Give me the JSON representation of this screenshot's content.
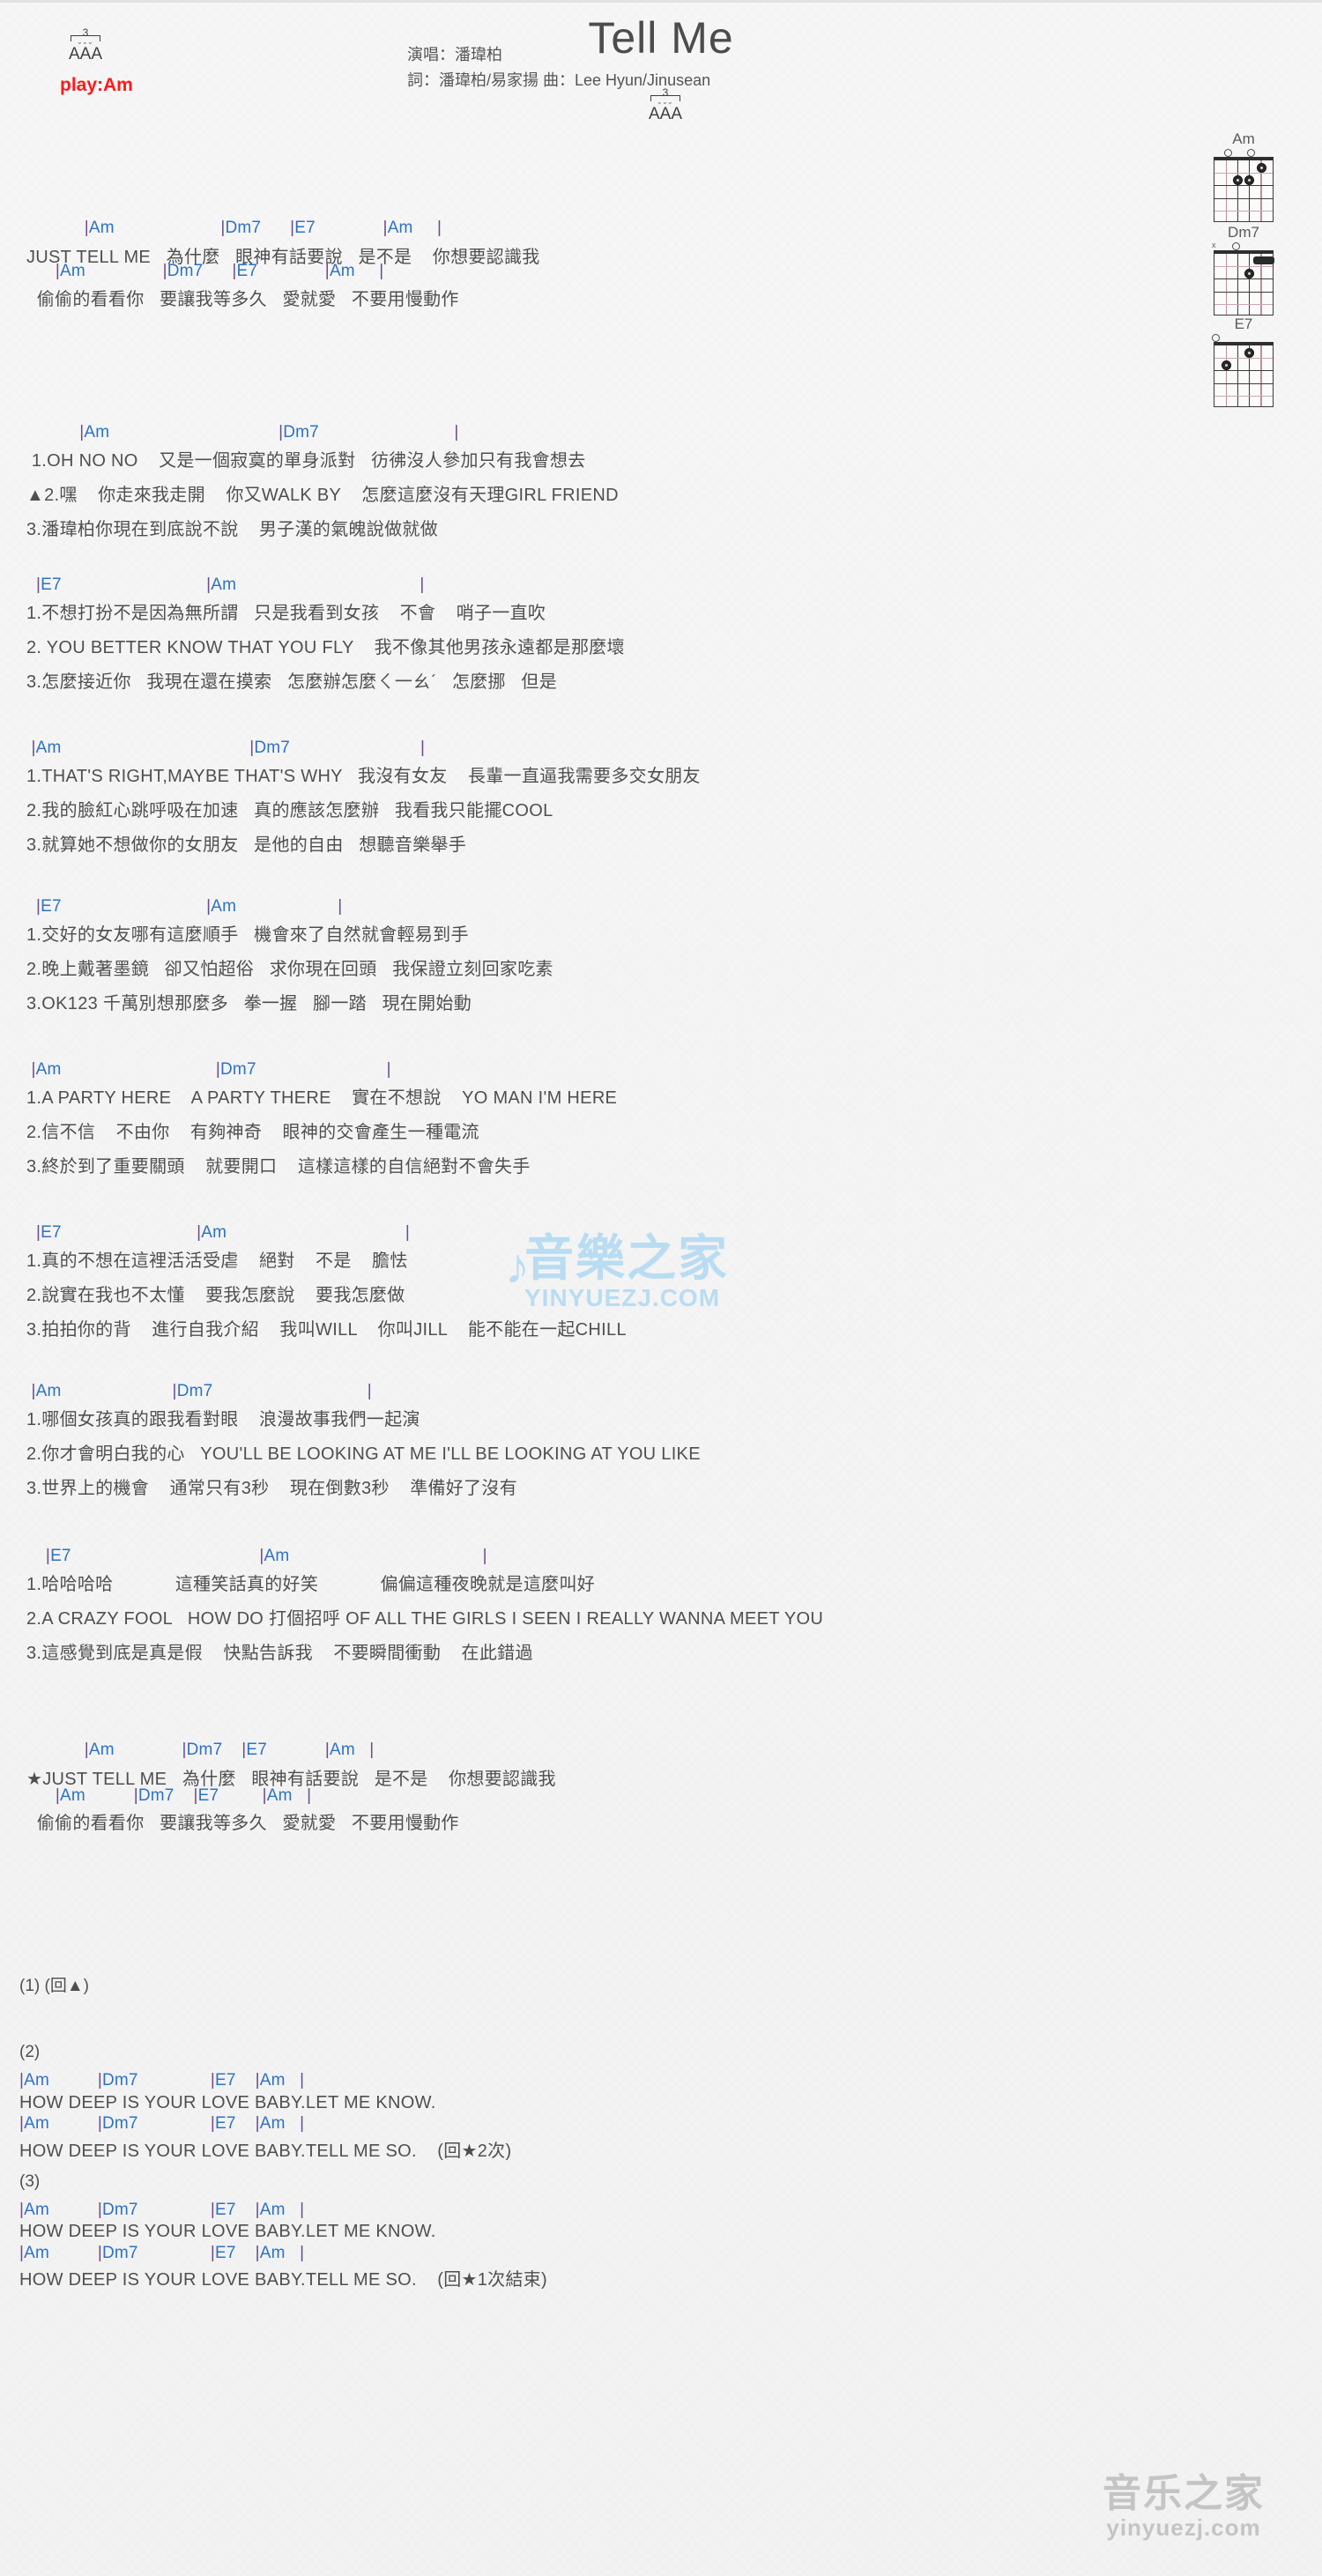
{
  "header": {
    "title": "Tell Me",
    "singer_line": "演唱：潘瑋柏",
    "credit_line": "詞：潘瑋柏/易家揚  曲：Lee Hyun/Jinusean",
    "play_key": "play:Am",
    "triplet_number": "3",
    "triplet_letters": "AAA"
  },
  "chord_diagrams": [
    {
      "name": "Am",
      "markers": "o  o",
      "shape": "x02210"
    },
    {
      "name": "Dm7",
      "markers": "x o",
      "shape": "xx0211"
    },
    {
      "name": "E7",
      "markers": "o",
      "shape": "020100"
    }
  ],
  "sections": [
    {
      "id": "intro-verse",
      "lines": [
        {
          "type": "chord",
          "text": "            |Am                      |Dm7      |E7              |Am     |"
        },
        {
          "type": "lyric",
          "text": "JUST TELL ME   為什麼   眼神有話要說   是不是    你想要認識我"
        },
        {
          "type": "chord",
          "text": "      |Am                |Dm7      |E7              |Am     |"
        },
        {
          "type": "lyric",
          "text": "  偷偷的看看你   要讓我等多久   愛就愛   不要用慢動作"
        }
      ]
    },
    {
      "id": "verse-block-1",
      "lines": [
        {
          "type": "chord",
          "text": "           |Am                                   |Dm7                            |"
        },
        {
          "type": "lyric",
          "text": " 1.OH NO NO    又是一個寂寞的單身派對   彷彿沒人參加只有我會想去"
        },
        {
          "type": "lyric",
          "text": "▲2.嘿    你走來我走開    你又WALK BY    怎麼這麼沒有天理GIRL FRIEND"
        },
        {
          "type": "lyric",
          "text": "3.潘瑋柏你現在到底說不說    男子漢的氣魄說做就做"
        }
      ]
    },
    {
      "id": "verse-block-2",
      "lines": [
        {
          "type": "chord",
          "text": "  |E7                              |Am                                      |"
        },
        {
          "type": "lyric",
          "text": "1.不想打扮不是因為無所謂   只是我看到女孩    不會    哨子一直吹"
        },
        {
          "type": "lyric",
          "text": "2. YOU BETTER KNOW THAT YOU FLY    我不像其他男孩永遠都是那麼壞"
        },
        {
          "type": "lyric",
          "text": "3.怎麼接近你   我現在還在摸索   怎麼辦怎麼ㄑ一ㄠˊ   怎麼挪   但是"
        }
      ]
    },
    {
      "id": "verse-block-3",
      "lines": [
        {
          "type": "chord",
          "text": " |Am                                       |Dm7                           |"
        },
        {
          "type": "lyric",
          "text": "1.THAT'S RIGHT,MAYBE THAT'S WHY   我沒有女友    長輩一直逼我需要多交女朋友"
        },
        {
          "type": "lyric",
          "text": "2.我的臉紅心跳呼吸在加速   真的應該怎麼辦   我看我只能擺COOL"
        },
        {
          "type": "lyric",
          "text": "3.就算她不想做你的女朋友   是他的自由   想聽音樂舉手"
        }
      ]
    },
    {
      "id": "verse-block-4",
      "lines": [
        {
          "type": "chord",
          "text": "  |E7                              |Am                     |"
        },
        {
          "type": "lyric",
          "text": "1.交好的女友哪有這麼順手   機會來了自然就會輕易到手"
        },
        {
          "type": "lyric",
          "text": "2.晚上戴著墨鏡   卻又怕超俗   求你現在回頭   我保證立刻回家吃素"
        },
        {
          "type": "lyric",
          "text": "3.OK123 千萬別想那麼多   拳一握   腳一踏   現在開始動"
        }
      ]
    },
    {
      "id": "verse-block-5",
      "lines": [
        {
          "type": "chord",
          "text": " |Am                                |Dm7                           |"
        },
        {
          "type": "lyric",
          "text": "1.A PARTY HERE    A PARTY THERE    實在不想說    YO MAN I'M HERE"
        },
        {
          "type": "lyric",
          "text": "2.信不信    不由你    有夠神奇    眼神的交會產生一種電流"
        },
        {
          "type": "lyric",
          "text": "3.終於到了重要關頭    就要開口    這樣這樣的自信絕對不會失手"
        }
      ]
    },
    {
      "id": "verse-block-6",
      "lines": [
        {
          "type": "chord",
          "text": "  |E7                            |Am                                     |"
        },
        {
          "type": "lyric",
          "text": "1.真的不想在這裡活活受虐    絕對    不是    膽怯"
        },
        {
          "type": "lyric",
          "text": "2.說實在我也不太懂    要我怎麼說    要我怎麼做"
        },
        {
          "type": "lyric",
          "text": "3.拍拍你的背    進行自我介紹    我叫WILL    你叫JILL    能不能在一起CHILL"
        }
      ]
    },
    {
      "id": "verse-block-7",
      "lines": [
        {
          "type": "chord",
          "text": " |Am                       |Dm7                                |"
        },
        {
          "type": "lyric",
          "text": "1.哪個女孩真的跟我看對眼    浪漫故事我們一起演"
        },
        {
          "type": "lyric",
          "text": "2.你才會明白我的心   YOU'LL BE LOOKING AT ME I'LL BE LOOKING AT YOU LIKE"
        },
        {
          "type": "lyric",
          "text": "3.世界上的機會    通常只有3秒    現在倒數3秒    準備好了沒有"
        }
      ]
    },
    {
      "id": "verse-block-8",
      "lines": [
        {
          "type": "chord",
          "text": "    |E7                                       |Am                                        |"
        },
        {
          "type": "lyric",
          "text": "1.哈哈哈哈            這種笑話真的好笑            偏偏這種夜晚就是這麼叫好"
        },
        {
          "type": "lyric",
          "text": "2.A CRAZY FOOL   HOW DO 打個招呼 OF ALL THE GIRLS I SEEN I REALLY WANNA MEET YOU"
        },
        {
          "type": "lyric",
          "text": "3.這感覺到底是真是假    快點告訴我    不要瞬間衝動    在此錯過"
        }
      ]
    },
    {
      "id": "chorus",
      "lines": [
        {
          "type": "chord",
          "text": "            |Am              |Dm7    |E7            |Am   |"
        },
        {
          "type": "lyric",
          "text": "★JUST TELL ME   為什麼   眼神有話要說   是不是    你想要認識我"
        },
        {
          "type": "chord",
          "text": "      |Am          |Dm7    |E7         |Am   |"
        },
        {
          "type": "lyric",
          "text": "  偷偷的看看你   要讓我等多久   愛就愛   不要用慢動作"
        }
      ]
    },
    {
      "id": "part-1",
      "label": "(1) (回▲)",
      "lines": []
    },
    {
      "id": "part-2",
      "label": "(2)",
      "lines": [
        {
          "type": "chord",
          "text": "|Am          |Dm7               |E7    |Am   |"
        },
        {
          "type": "lyric",
          "text": "HOW DEEP IS YOUR LOVE BABY.LET ME KNOW."
        },
        {
          "type": "chord",
          "text": "|Am          |Dm7               |E7    |Am   |"
        },
        {
          "type": "lyric",
          "text": "HOW DEEP IS YOUR LOVE BABY.TELL ME SO.    (回★2次)"
        }
      ]
    },
    {
      "id": "part-3",
      "label": "(3)",
      "lines": [
        {
          "type": "chord",
          "text": "|Am          |Dm7               |E7    |Am   |"
        },
        {
          "type": "lyric",
          "text": "HOW DEEP IS YOUR LOVE BABY.LET ME KNOW."
        },
        {
          "type": "chord",
          "text": "|Am          |Dm7               |E7    |Am   |"
        },
        {
          "type": "lyric",
          "text": "HOW DEEP IS YOUR LOVE BABY.TELL ME SO.    (回★1次結束)"
        }
      ]
    }
  ],
  "watermark": {
    "center_cn": "音樂之家",
    "center_en": "YINYUEZJ.COM",
    "bottom_cn": "音乐之家",
    "bottom_en": "yinyuezj.com"
  },
  "colors": {
    "chord": "#2d72c4",
    "bar": "#6e4a8c",
    "lyric": "#4f4f4f",
    "key_red": "#ff1a1a",
    "watermark_blue": "#b9dcf2",
    "watermark_gray": "#c4c4c4"
  }
}
